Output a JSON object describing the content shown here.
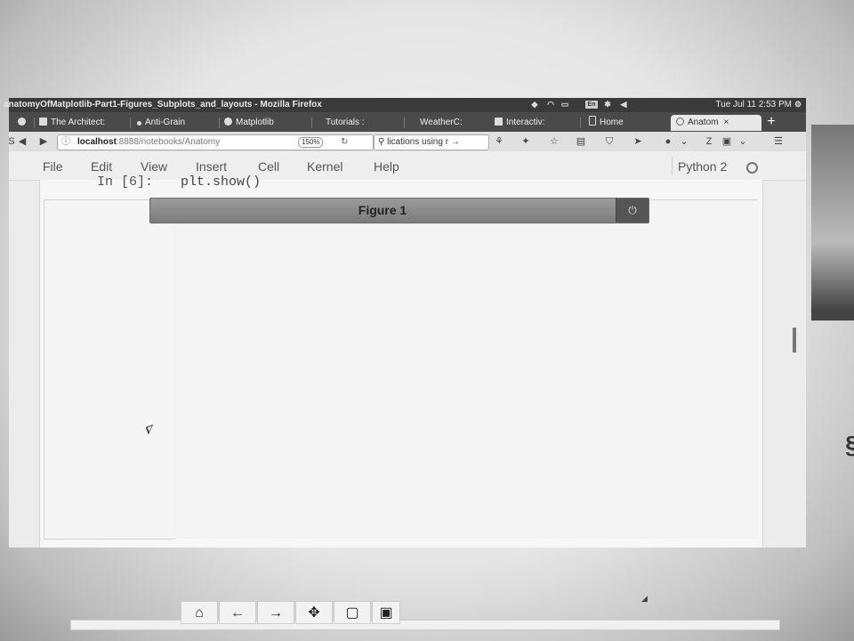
{
  "window": {
    "title": "anatomyOfMatplotlib-Part1-Figures_Subplots_and_layouts - Mozilla Firefox",
    "clock": "Tue Jul 11  2:53 PM"
  },
  "tabs": [
    {
      "label": "The Architect:"
    },
    {
      "label": "Anti-Grain"
    },
    {
      "label": "Matplotlib"
    },
    {
      "label": "Tutorials :"
    },
    {
      "label": "WeatherC:"
    },
    {
      "label": "Interactiv:"
    },
    {
      "label": "Home"
    },
    {
      "label": "Anatom",
      "active": true
    }
  ],
  "tab_close": "×",
  "tab_new": "+",
  "navbar": {
    "url_host": "localhost",
    "url_rest": ":8888/notebooks/Anatomy",
    "zoom": "150%",
    "search": "lications using r",
    "search_arrow": "→"
  },
  "menubar": {
    "items": [
      "File",
      "Edit",
      "View",
      "Insert",
      "Cell",
      "Kernel",
      "Help"
    ],
    "kernel": "Python 2"
  },
  "cell": {
    "prompt": "In [6]:",
    "code": "plt.show()"
  },
  "figure": {
    "title": "Figure 1",
    "close_icon": "power-icon"
  },
  "toolbar": [
    {
      "name": "home-icon",
      "glyph": "⌂"
    },
    {
      "name": "back-arrow-icon",
      "glyph": "←"
    },
    {
      "name": "forward-arrow-icon",
      "glyph": "→"
    },
    {
      "name": "pan-icon",
      "glyph": "✥"
    },
    {
      "name": "zoom-rect-icon",
      "glyph": "▢"
    },
    {
      "name": "save-icon",
      "glyph": "▣"
    }
  ]
}
